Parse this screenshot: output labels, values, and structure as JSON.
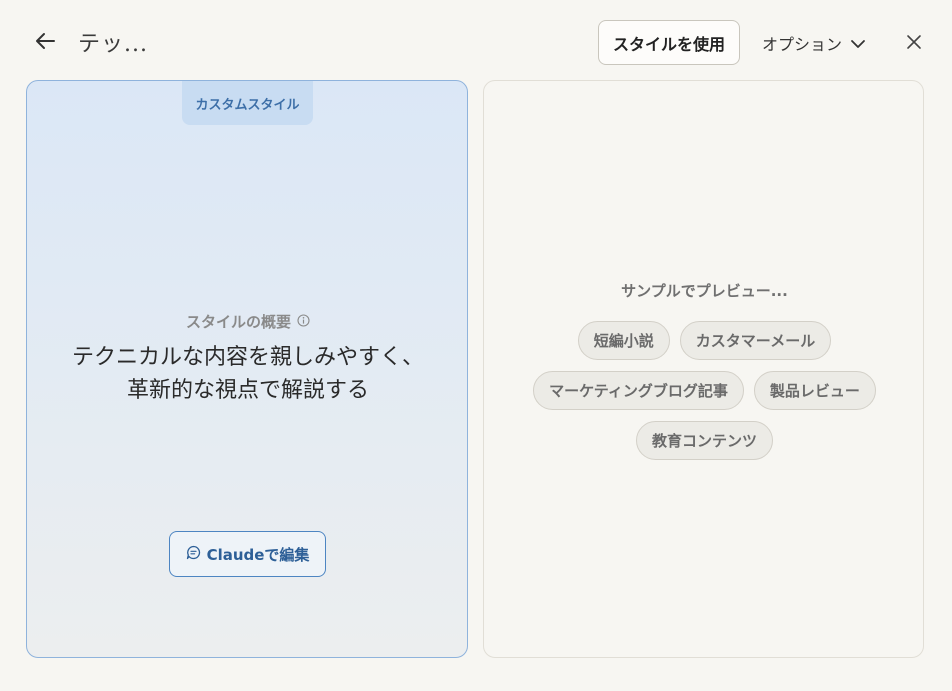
{
  "header": {
    "title": "テッ...",
    "use_style_label": "スタイルを使用",
    "options_label": "オプション"
  },
  "left_panel": {
    "tab_label": "カスタムスタイル",
    "overview_label": "スタイルの概要",
    "overview_text": "テクニカルな内容を親しみやすく、革新的な視点で解説する",
    "edit_label": "Claudeで編集"
  },
  "right_panel": {
    "preview_label": "サンプルでプレビュー...",
    "samples": [
      "短編小説",
      "カスタマーメール",
      "マーケティングブログ記事",
      "製品レビュー",
      "教育コンテンツ"
    ]
  },
  "icons": {
    "back": "arrow-left-icon",
    "options_chevron": "chevron-down-icon",
    "close": "close-icon",
    "info": "info-icon",
    "chat": "chat-bubble-icon"
  },
  "colors": {
    "accent": "#2d5f97",
    "accent_border": "#4d85c2",
    "panel_tint": "#dbe7f6",
    "background": "#f7f6f2"
  }
}
